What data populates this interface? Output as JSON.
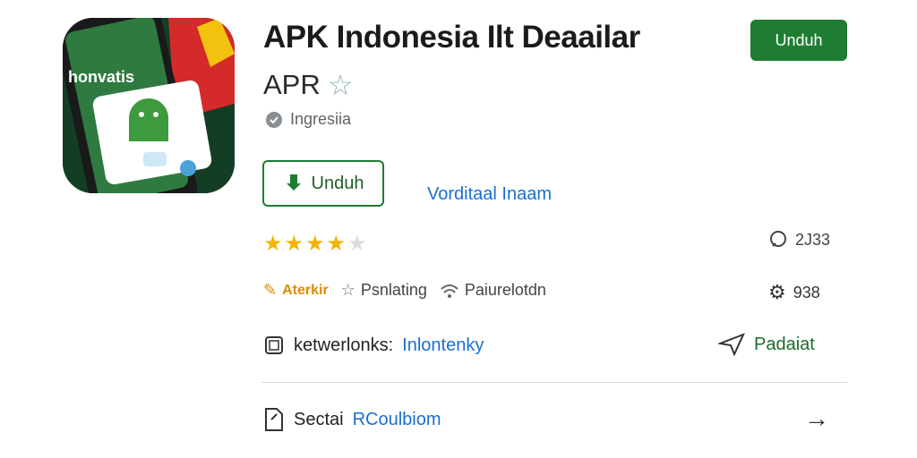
{
  "app": {
    "title": "APK Indonesia Ilt Deaailar",
    "subtitle": "APR",
    "region": "Ingresiia",
    "icon_text": "honvatis"
  },
  "header": {
    "download_label": "Unduh"
  },
  "actions": {
    "download_outline_label": "Unduh",
    "verify_link": "Vorditaal Inaam"
  },
  "rating": {
    "stars": 4,
    "max": 5,
    "review_count": "2J33"
  },
  "meta": {
    "badge": "Aterkir",
    "category1": "Psnlating",
    "category2": "Paiurelotdn",
    "installs": "938"
  },
  "network": {
    "label": "ketwerlonks:",
    "value": "Inlontenky",
    "share": "Padaiat"
  },
  "section": {
    "label": "Sectai",
    "value": "RCoulbiom"
  },
  "colors": {
    "accent_green": "#1e7d32",
    "link_blue": "#1a6fd1",
    "star": "#f4b400"
  },
  "icons": [
    "app-icon",
    "star-icon",
    "location-icon",
    "download-icon",
    "comment-icon",
    "gear-icon",
    "wifi-icon",
    "device-icon",
    "send-icon",
    "document-icon",
    "arrow-right-icon"
  ]
}
